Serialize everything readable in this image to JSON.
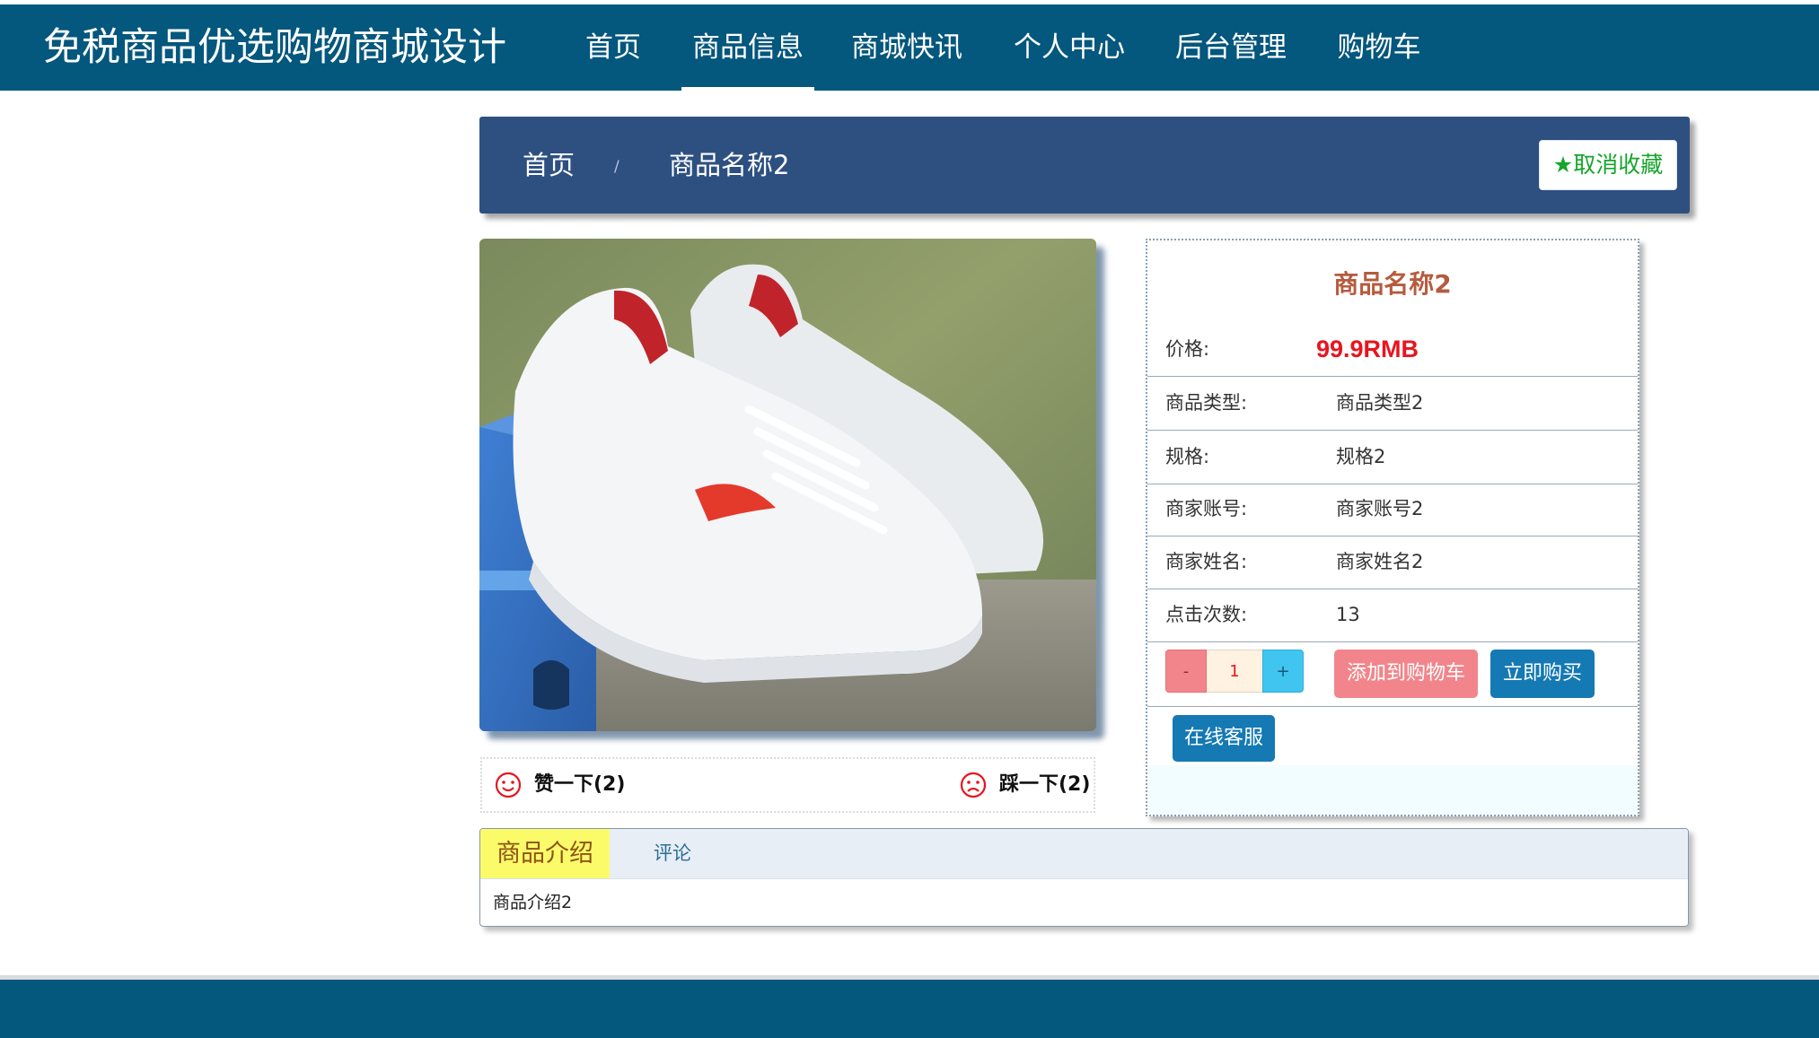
{
  "header": {
    "site_title": "免税商品优选购物商城设计",
    "nav": [
      {
        "label": "首页",
        "active": false
      },
      {
        "label": "商品信息",
        "active": true
      },
      {
        "label": "商城快讯",
        "active": false
      },
      {
        "label": "个人中心",
        "active": false
      },
      {
        "label": "后台管理",
        "active": false
      },
      {
        "label": "购物车",
        "active": false
      }
    ]
  },
  "breadcrumb": {
    "home": "首页",
    "separator": "/",
    "current": "商品名称2",
    "favorite_icon": "star-icon",
    "favorite_label": "取消收藏"
  },
  "product": {
    "image_alt": "white-red-sneaker",
    "name": "商品名称2",
    "fields": [
      {
        "label": "价格:",
        "value": "99.9RMB"
      },
      {
        "label": "商品类型:",
        "value": "商品类型2"
      },
      {
        "label": "规格:",
        "value": "规格2"
      },
      {
        "label": "商家账号:",
        "value": "商家账号2"
      },
      {
        "label": "商家姓名:",
        "value": "商家姓名2"
      },
      {
        "label": "点击次数:",
        "value": "13"
      }
    ],
    "quantity": {
      "minus": "-",
      "value": "1",
      "plus": "+"
    },
    "add_to_cart": "添加到购物车",
    "buy_now": "立即购买",
    "online_service": "在线客服"
  },
  "votes": {
    "like": {
      "icon": "smile-icon",
      "label": "赞一下(2)"
    },
    "dislike": {
      "icon": "frown-icon",
      "label": "踩一下(2)"
    }
  },
  "tabs": {
    "items": [
      {
        "label": "商品介绍",
        "active": true
      },
      {
        "label": "评论",
        "active": false
      }
    ],
    "content": "商品介绍2"
  },
  "colors": {
    "nav_bg": "#04577d",
    "breadcrumb_bg": "#2d5081",
    "price": "#e8141e",
    "title": "#b55b3e",
    "favorite": "#16a52c",
    "primary_button": "#1579b4",
    "cart_button": "#f2858b"
  }
}
